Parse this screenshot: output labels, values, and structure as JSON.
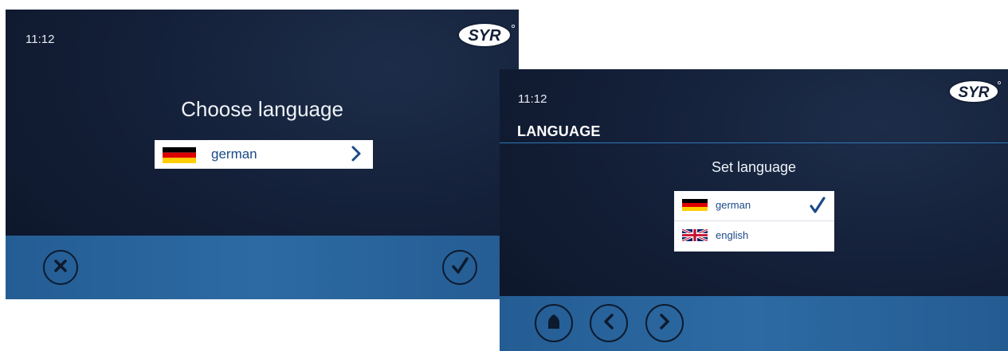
{
  "screens": [
    {
      "time": "11:12",
      "logo": "SYR",
      "heading": "Choose language",
      "selected_language": {
        "label": "german",
        "flag": "german-flag-icon"
      },
      "bottom_bar": {
        "left": "cancel-icon",
        "right": "confirm-icon"
      }
    },
    {
      "time": "11:12",
      "logo": "SYR",
      "section_title": "LANGUAGE",
      "heading": "Set language",
      "languages": [
        {
          "label": "german",
          "flag": "german-flag-icon",
          "selected": true
        },
        {
          "label": "english",
          "flag": "uk-flag-icon",
          "selected": false
        }
      ],
      "bottom_bar": [
        "home-icon",
        "back-icon",
        "forward-icon"
      ]
    }
  ],
  "colors": {
    "screen_bg": "#142039",
    "bottom_bar": "#2d6aa3",
    "accent_blue": "#1b4a86",
    "divider_blue": "#2d78b9"
  }
}
